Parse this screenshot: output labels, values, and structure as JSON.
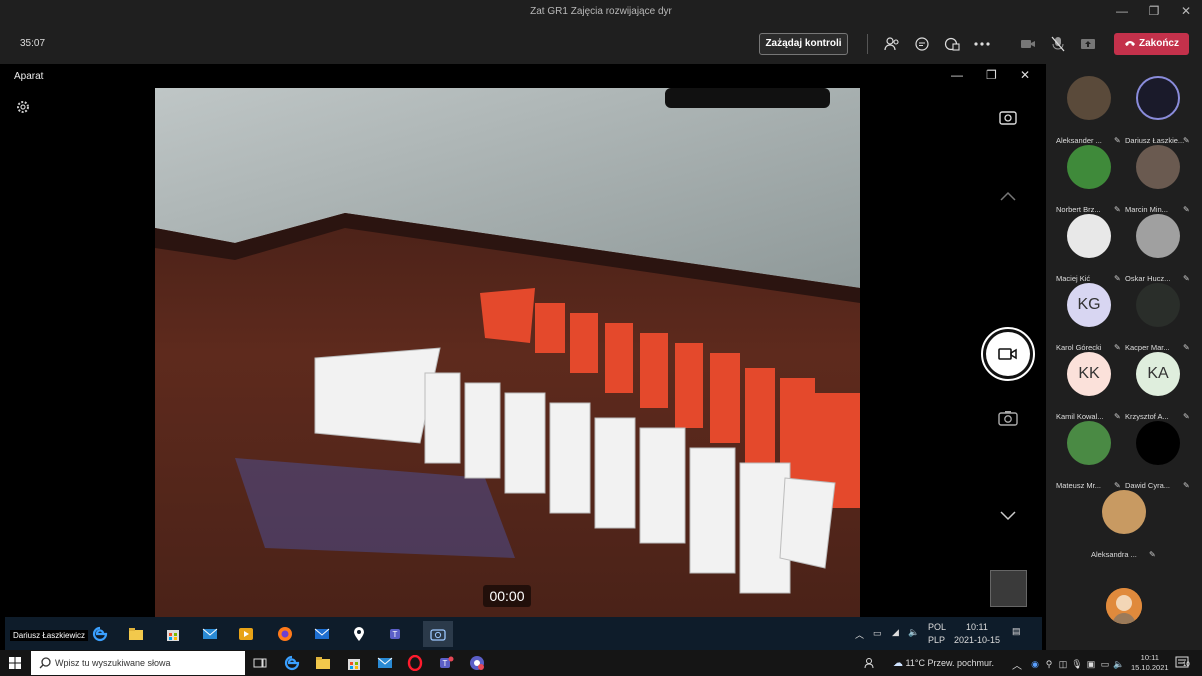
{
  "window": {
    "title": "Zat GR1 Zajęcia rozwijające dyr",
    "minimize": "—",
    "maximize": "❐",
    "close": "✕"
  },
  "meeting": {
    "timer": "35:07",
    "request_control": "Zażądaj kontroli",
    "end_call": "Zakończ",
    "icons": [
      "participants-icon",
      "chat-icon",
      "reactions-icon",
      "more-icon",
      "camera-off-icon",
      "mic-off-icon",
      "share-icon"
    ]
  },
  "camera_app": {
    "title": "Aparat",
    "elapsed": "00:00",
    "controls": [
      "settings-icon",
      "switch-camera-icon",
      "chevron-up-icon",
      "video-record-button",
      "photo-icon",
      "chevron-down-icon"
    ]
  },
  "inner_taskbar": {
    "label": "Dariusz Łaszkiewicz",
    "lang_top": "POL",
    "lang_bottom": "PLP",
    "time": "10:11",
    "date": "2021-10-15"
  },
  "participants": [
    {
      "name": "Aleksander ...",
      "initials": "",
      "avatar_color": "#5a4a3a"
    },
    {
      "name": "Dariusz Łaszkie...",
      "initials": "",
      "avatar_color": "#1a1a2a"
    },
    {
      "name": "Norbert Brz...",
      "initials": "",
      "avatar_color": "#3f8a3a"
    },
    {
      "name": "Marcin Min...",
      "initials": "",
      "avatar_color": "#6a5a50"
    },
    {
      "name": "Maciej Kić",
      "initials": "",
      "avatar_color": "#e8e8e8"
    },
    {
      "name": "Oskar Hucz...",
      "initials": "",
      "avatar_color": "#a0a0a0"
    },
    {
      "name": "Karol Górecki",
      "initials": "KG",
      "avatar_color": "#d8d6f2"
    },
    {
      "name": "Kacper Mar...",
      "initials": "",
      "avatar_color": "#2a2e2a"
    },
    {
      "name": "Kamil Kowal...",
      "initials": "KK",
      "avatar_color": "#fbe1da"
    },
    {
      "name": "Krzysztof A...",
      "initials": "KA",
      "avatar_color": "#dfeedd"
    },
    {
      "name": "Mateusz Mr...",
      "initials": "",
      "avatar_color": "#4a8a44"
    },
    {
      "name": "Dawid Cyra...",
      "initials": "",
      "avatar_color": "#000000"
    },
    {
      "name": "Aleksandra ...",
      "initials": "",
      "avatar_color": "#c89a62"
    }
  ],
  "taskbar": {
    "search_placeholder": "Wpisz tu wyszukiwane słowa",
    "weather": "11°C  Przew. pochmur.",
    "time": "10:11",
    "date": "15.10.2021",
    "notifications": "10"
  }
}
